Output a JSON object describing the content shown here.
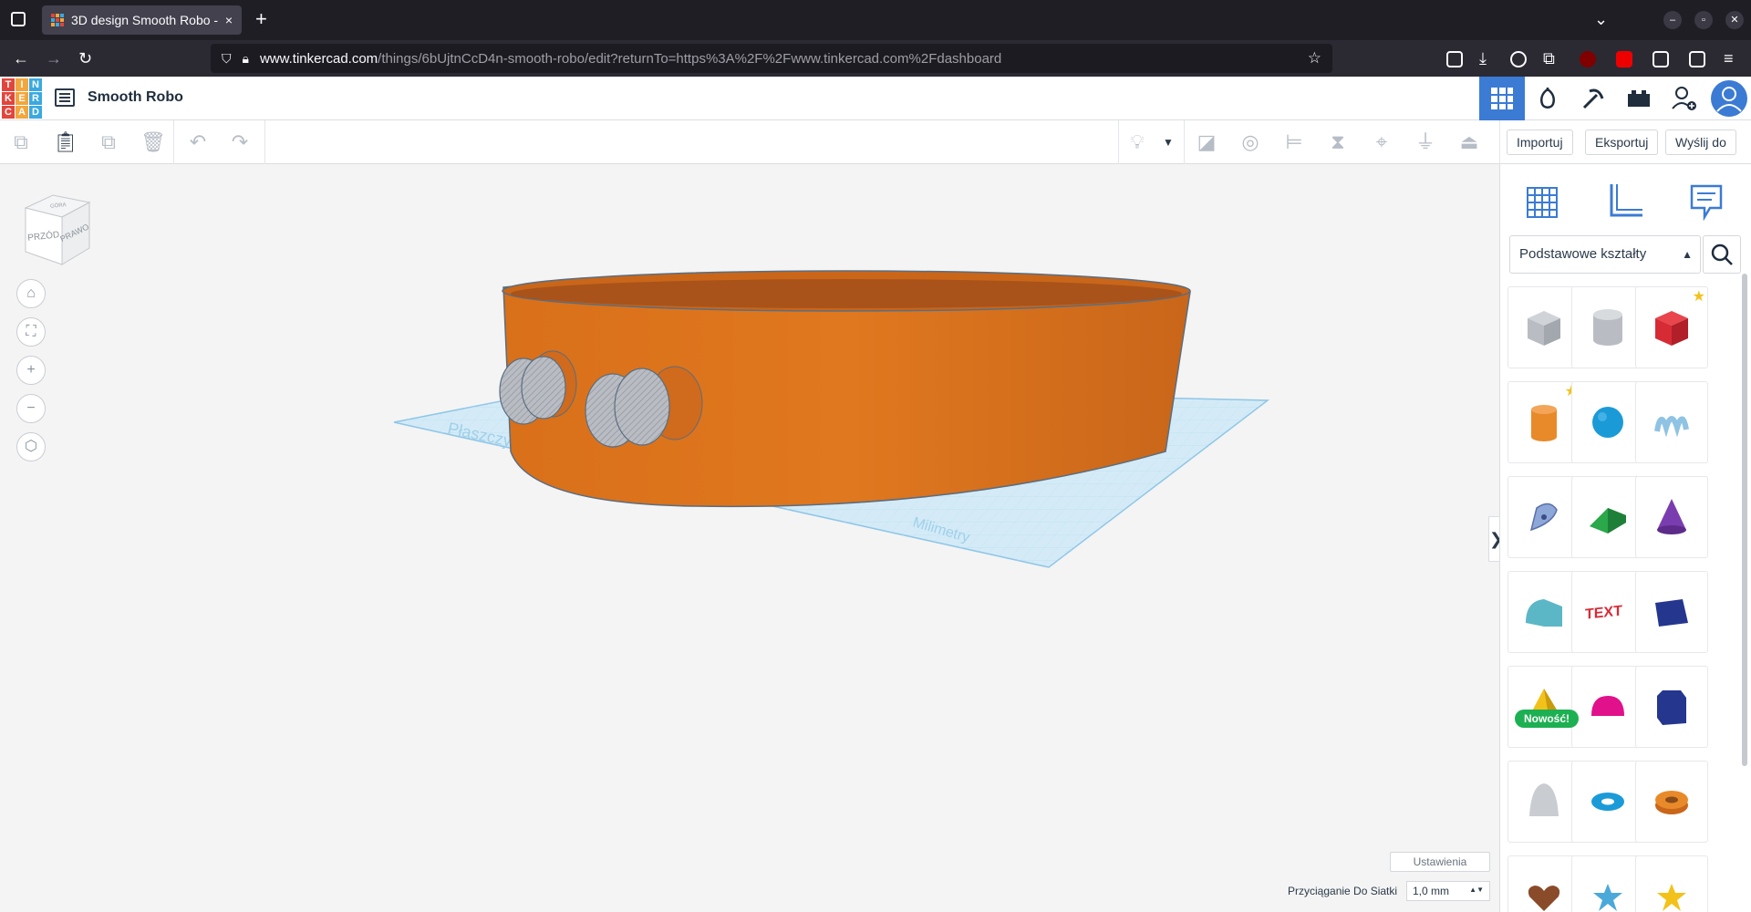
{
  "browser": {
    "tab_title": "3D design Smooth Robo -",
    "tab_close": "×",
    "new_tab": "+",
    "url_host": "www.tinkercad.com",
    "url_path": "/things/6bUjtnCcD4n-smooth-robo/edit?returnTo=https%3A%2F%2Fwww.tinkercad.com%2Fdashboard"
  },
  "app": {
    "logo_letters": [
      "T",
      "I",
      "N",
      "K",
      "E",
      "R",
      "C",
      "A",
      "D"
    ],
    "logo_colors": [
      "#e2453c",
      "#f3a63b",
      "#3ba9e0",
      "#e2453c",
      "#f3a63b",
      "#3ba9e0",
      "#e2453c",
      "#f3a63b",
      "#3ba9e0"
    ],
    "design_title": "Smooth Robo",
    "accent": "#3b7bd4"
  },
  "toolbar": {
    "import_label": "Importuj",
    "export_label": "Eksportuj",
    "send_label": "Wyślij do"
  },
  "viewcube": {
    "front": "PRZÓD",
    "right": "PRAWO",
    "top": "GÓRA"
  },
  "workplane": {
    "label_left": "Płaszczyzna",
    "label_right": "Milimetry"
  },
  "panel": {
    "category_select": "Podstawowe kształty",
    "new_badge": "Nowość!",
    "collapse_glyph": "❯",
    "shapes": [
      {
        "name": "box-hole",
        "color": "#b9bdc3"
      },
      {
        "name": "cylinder-hole",
        "color": "#b9bdc3"
      },
      {
        "name": "box",
        "color": "#d62b35"
      },
      {
        "name": "cylinder",
        "color": "#e88a2a"
      },
      {
        "name": "sphere",
        "color": "#1a9bd7"
      },
      {
        "name": "scribble",
        "color": "#8fc3e3"
      },
      {
        "name": "shape-generator",
        "color": "#8da7d9"
      },
      {
        "name": "roof",
        "color": "#2aa84a"
      },
      {
        "name": "cone",
        "color": "#7a3db0"
      },
      {
        "name": "round-roof",
        "color": "#5bb7c6"
      },
      {
        "name": "text",
        "color": "#d62b35"
      },
      {
        "name": "wedge",
        "color": "#25368f"
      },
      {
        "name": "pyramid",
        "color": "#f3c21a"
      },
      {
        "name": "half-sphere",
        "color": "#e0118a"
      },
      {
        "name": "polygon",
        "color": "#25368f"
      },
      {
        "name": "paraboloid",
        "color": "#c9ccd1"
      },
      {
        "name": "torus",
        "color": "#1a9bd7"
      },
      {
        "name": "tube",
        "color": "#e88a2a"
      },
      {
        "name": "heart",
        "color": "#8a4b2a"
      },
      {
        "name": "star",
        "color": "#4aa9d9"
      },
      {
        "name": "star-gold",
        "color": "#f3c21a"
      }
    ]
  },
  "footer": {
    "settings_label": "Ustawienia",
    "snap_label": "Przyciąganie Do Siatki",
    "snap_value": "1,0 mm"
  }
}
